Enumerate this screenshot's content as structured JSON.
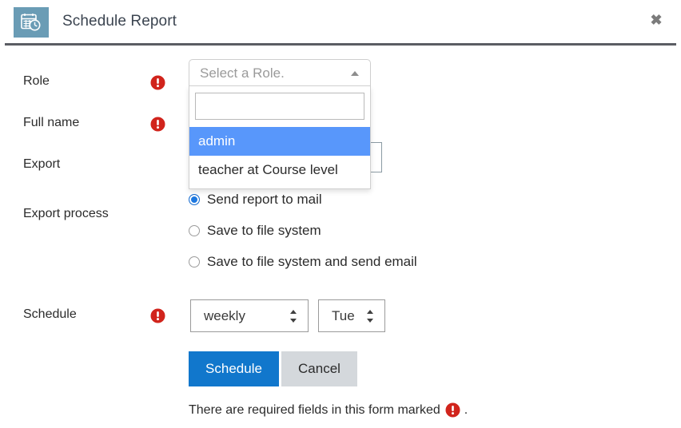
{
  "header": {
    "title": "Schedule Report",
    "icon": "calendar-clock-icon",
    "icon_bg": "#6a9cb5",
    "close_label": "✖"
  },
  "form": {
    "fields": [
      {
        "label": "Role",
        "required": true
      },
      {
        "label": "Full name",
        "required": true
      },
      {
        "label": "Export",
        "required": false
      },
      {
        "label": "Export process",
        "required": false
      },
      {
        "label": "Schedule",
        "required": true
      }
    ],
    "role_select": {
      "selected_text": "Select a Role.",
      "is_open": true,
      "search_value": "",
      "search_placeholder": "",
      "arrow_icon": "caret-up-icon",
      "options": [
        {
          "label": "admin",
          "highlighted": true
        },
        {
          "label": "teacher at Course level",
          "highlighted": false
        }
      ]
    },
    "export_input": {
      "value": ""
    },
    "export_process": {
      "options": [
        {
          "label": "Send report to mail",
          "checked": true
        },
        {
          "label": "Save to file system",
          "checked": false
        },
        {
          "label": "Save to file system and send email",
          "checked": false
        }
      ]
    },
    "schedule": {
      "frequency": {
        "value": "weekly"
      },
      "day": {
        "value": "Tue"
      }
    },
    "buttons": {
      "submit": "Schedule",
      "cancel": "Cancel"
    },
    "note": {
      "text_before": "There are required fields in this form marked",
      "text_after": "."
    }
  },
  "colors": {
    "primary": "#1177cc",
    "highlight": "#5897fb",
    "required": "#d1241c",
    "icon_bg": "#6a9cb5",
    "divider": "#5b5d63"
  }
}
